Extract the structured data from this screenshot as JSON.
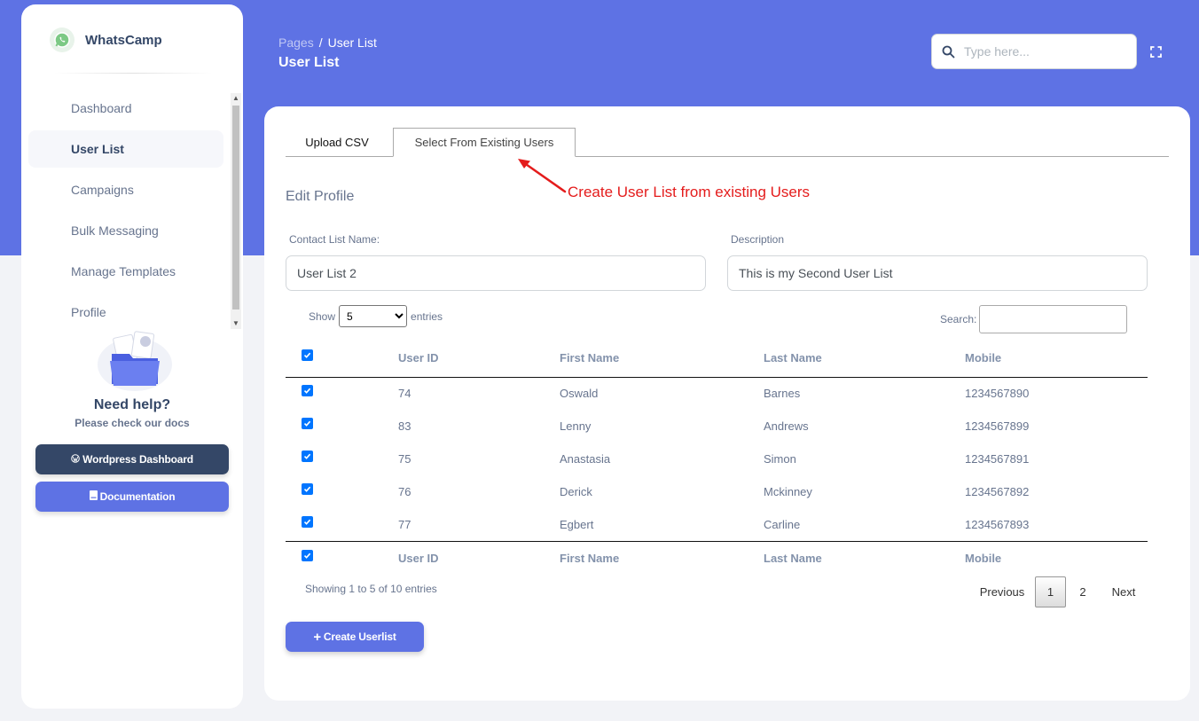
{
  "sidebar": {
    "brand": "WhatsCamp",
    "items": [
      {
        "label": "Dashboard"
      },
      {
        "label": "User List"
      },
      {
        "label": "Campaigns"
      },
      {
        "label": "Bulk Messaging"
      },
      {
        "label": "Manage Templates"
      },
      {
        "label": "Profile"
      }
    ],
    "help_title": "Need help?",
    "help_subtitle": "Please check our docs",
    "wordpress_button": "Wordpress Dashboard",
    "docs_button": "Documentation"
  },
  "header": {
    "breadcrumb_root": "Pages",
    "breadcrumb_sep": "/",
    "breadcrumb_current": "User List",
    "title": "User List",
    "search_placeholder": "Type here..."
  },
  "tabs": {
    "upload": "Upload CSV",
    "existing": "Select From Existing Users"
  },
  "annotation": "Create User List from existing Users",
  "form": {
    "heading": "Edit Profile",
    "name_label": "Contact List Name:",
    "name_value": "User List 2",
    "desc_label": "Description",
    "desc_value": "This is my Second User List"
  },
  "datatable": {
    "show_label": "Show",
    "entries_label": "entries",
    "page_size": "5",
    "page_size_options": [
      "5"
    ],
    "search_label": "Search:",
    "columns": [
      "User ID",
      "First Name",
      "Last Name",
      "Mobile"
    ],
    "rows": [
      {
        "id": "74",
        "first": "Oswald",
        "last": "Barnes",
        "mobile": "1234567890"
      },
      {
        "id": "83",
        "first": "Lenny",
        "last": "Andrews",
        "mobile": "1234567899"
      },
      {
        "id": "75",
        "first": "Anastasia",
        "last": "Simon",
        "mobile": "1234567891"
      },
      {
        "id": "76",
        "first": "Derick",
        "last": "Mckinney",
        "mobile": "1234567892"
      },
      {
        "id": "77",
        "first": "Egbert",
        "last": "Carline",
        "mobile": "1234567893"
      }
    ],
    "info": "Showing 1 to 5 of 10 entries",
    "prev": "Previous",
    "pages": [
      "1",
      "2"
    ],
    "next": "Next"
  },
  "create_button": "Create Userlist",
  "colors": {
    "primary": "#5e72e4",
    "dark": "#344767",
    "annotation": "#e41c1c",
    "checkbox": "#0075ff"
  }
}
